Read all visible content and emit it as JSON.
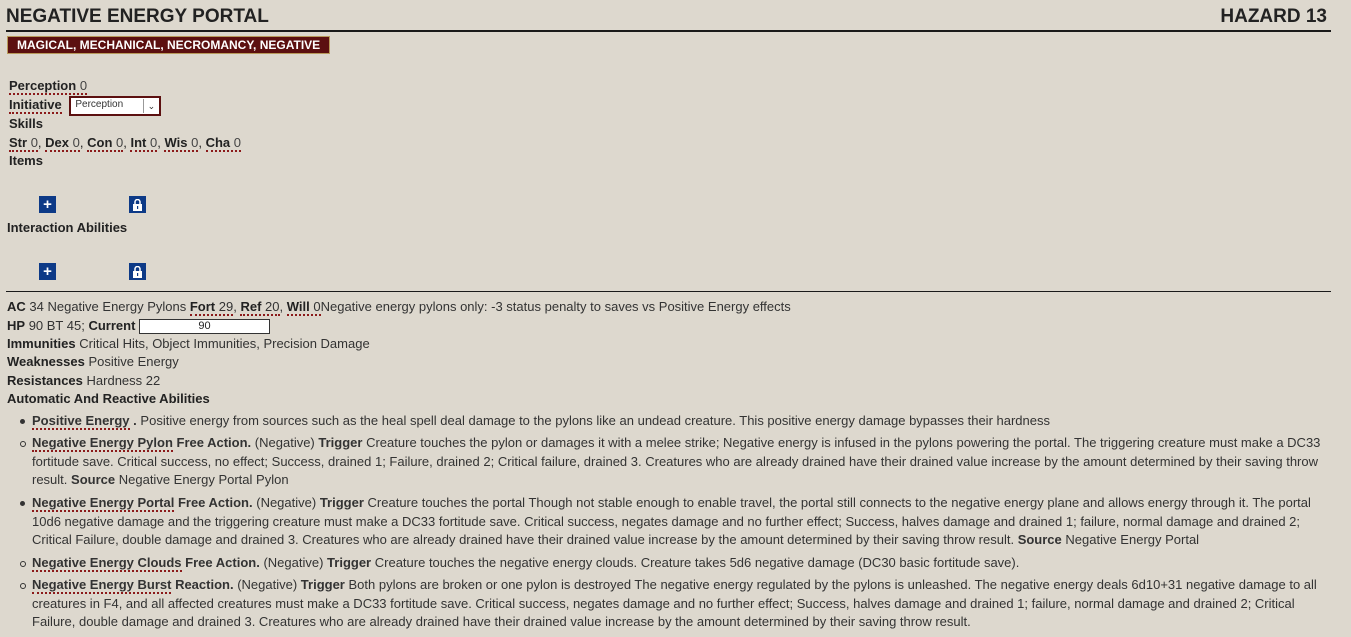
{
  "header": {
    "title": "NEGATIVE ENERGY PORTAL",
    "level": "HAZARD 13"
  },
  "traits": [
    "MAGICAL",
    "MECHANICAL",
    "NECROMANCY",
    "NEGATIVE"
  ],
  "perception": {
    "label": "Perception",
    "value": "0"
  },
  "initiative": {
    "label": "Initiative",
    "selected": "Perception"
  },
  "skills": {
    "label": "Skills"
  },
  "attributes": [
    {
      "label": "Str",
      "value": "0"
    },
    {
      "label": "Dex",
      "value": "0"
    },
    {
      "label": "Con",
      "value": "0"
    },
    {
      "label": "Int",
      "value": "0"
    },
    {
      "label": "Wis",
      "value": "0"
    },
    {
      "label": "Cha",
      "value": "0"
    }
  ],
  "items": {
    "label": "Items"
  },
  "interaction": {
    "label": "Interaction Abilities"
  },
  "defense": {
    "ac_label": "AC",
    "ac_value": "34 Negative Energy Pylons",
    "fort_label": "Fort",
    "fort_value": "29",
    "ref_label": "Ref",
    "ref_value": "20",
    "will_label": "Will",
    "will_value": "0",
    "save_note": "Negative energy pylons only: -3 status penalty to saves vs Positive Energy effects",
    "hp_label": "HP",
    "hp_value": "90 BT 45;",
    "current_label": "Current",
    "current_value": "90",
    "immunities_label": "Immunities",
    "immunities_value": "Critical Hits, Object Immunities, Precision Damage",
    "weaknesses_label": "Weaknesses",
    "weaknesses_value": "Positive Energy",
    "resistances_label": "Resistances",
    "resistances_value": "Hardness 22"
  },
  "reactive": {
    "heading": "Automatic And Reactive Abilities",
    "abilities": [
      {
        "name": "Positive Energy",
        "action": ".",
        "traits": "",
        "trigger_label": "",
        "text": "Positive energy from sources such as the heal spell deal damage to the pylons like an undead creature. This positive energy damage bypasses their hardness",
        "source_label": "",
        "source": ""
      },
      {
        "name": "Negative Energy Pylon",
        "action": "Free Action.",
        "traits": "(Negative)",
        "trigger_label": "Trigger",
        "text": "Creature touches the pylon or damages it with a melee strike; Negative energy is infused in the pylons powering the portal. The triggering creature must make a DC33 fortitude save. Critical success, no effect; Success, drained 1; Failure, drained 2; Critical failure, drained 3. Creatures who are already drained have their drained value increase by the amount determined by their saving throw result.",
        "source_label": "Source",
        "source": "Negative Energy Portal Pylon"
      },
      {
        "name": "Negative Energy Portal",
        "action": "Free Action.",
        "traits": "(Negative)",
        "trigger_label": "Trigger",
        "text": "Creature touches the portal Though not stable enough to enable travel, the portal still connects to the negative energy plane and allows energy through it. The portal 10d6 negative damage and the triggering creature must make a DC33 fortitude save. Critical success, negates damage and no further effect; Success, halves damage and drained 1; failure, normal damage and drained 2; Critical Failure, double damage and drained 3. Creatures who are already drained have their drained value increase by the amount determined by their saving throw result.",
        "source_label": "Source",
        "source": "Negative Energy Portal"
      },
      {
        "name": "Negative Energy Clouds",
        "action": "Free Action.",
        "traits": "(Negative)",
        "trigger_label": "Trigger",
        "text": "Creature touches the negative energy clouds. Creature takes 5d6 negative damage (DC30 basic fortitude save).",
        "source_label": "",
        "source": ""
      },
      {
        "name": "Negative Energy Burst",
        "action": "Reaction.",
        "traits": "(Negative)",
        "trigger_label": "Trigger",
        "text": "Both pylons are broken or one pylon is destroyed The negative energy regulated by the pylons is unleashed. The negative energy deals 6d10+31 negative damage to all creatures in F4, and all affected creatures must make a DC33 fortitude save. Critical success, negates damage and no further effect; Success, halves damage and drained 1; failure, normal damage and drained 2; Critical Failure, double damage and drained 3. Creatures who are already drained have their drained value increase by the amount determined by their saving throw result.",
        "source_label": "",
        "source": ""
      }
    ]
  },
  "colors": {
    "background": "#ddd8ce",
    "trait_bg": "#5c1010",
    "button_bg": "#0d3a87",
    "dotted_underline": "#8b1a1a"
  },
  "icons": [
    "plus-icon",
    "lock-icon",
    "chevron-down-icon"
  ]
}
